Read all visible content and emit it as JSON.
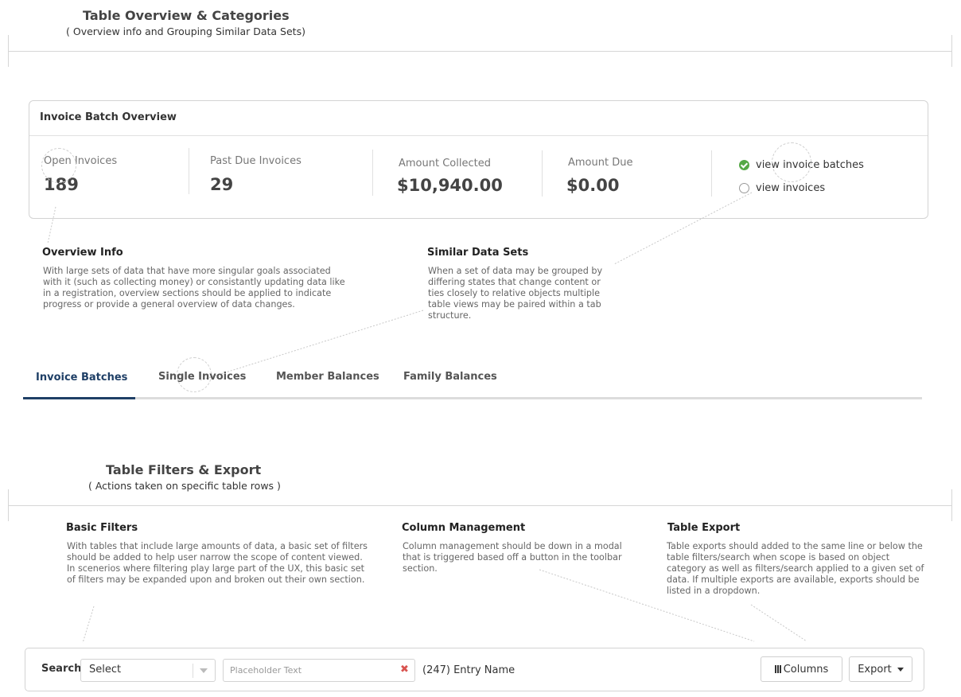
{
  "section1": {
    "title": "Table Overview & Categories",
    "subtitle": "( Overview info and Grouping Similar Data Sets)"
  },
  "overview_card": {
    "title": "Invoice Batch Overview",
    "stats": [
      {
        "label": "Open Invoices",
        "value": "189"
      },
      {
        "label": "Past Due Invoices",
        "value": "29"
      },
      {
        "label": "Amount Collected",
        "value": "$10,940.00"
      },
      {
        "label": "Amount Due",
        "value": "$0.00"
      }
    ],
    "view_options": [
      {
        "label": "view invoice batches",
        "selected": true
      },
      {
        "label": "view invoices",
        "selected": false
      }
    ]
  },
  "notes_overview": [
    {
      "title": "Overview Info",
      "text": "With large sets of data that have more singular goals associated with it (such as collecting money) or consistantly updating data like in a registration, overview sections should be applied to indicate progress or provide a general overview of data changes."
    },
    {
      "title": "Similar Data Sets",
      "text": "When a set of data may be grouped by differing states that change content or ties closely to relative objects multiple table views may be paired within a tab structure."
    }
  ],
  "tabs": [
    {
      "label": "Invoice Batches",
      "active": true
    },
    {
      "label": "Single Invoices",
      "active": false
    },
    {
      "label": "Member Balances",
      "active": false
    },
    {
      "label": "Family Balances",
      "active": false
    }
  ],
  "section2": {
    "title": "Table Filters & Export",
    "subtitle": "( Actions taken on specific table rows )"
  },
  "notes_filters": [
    {
      "title": "Basic Filters",
      "text": "With tables that include large amounts of data, a basic set of filters should be added to help user narrow the scope of content viewed. In scenerios where filtering play large part of the UX, this basic set of filters may be expanded upon and broken out their own section."
    },
    {
      "title": "Column Management",
      "text": "Column management should be down in a modal that is triggered based off a button in the toolbar section."
    },
    {
      "title": "Table Export",
      "text": "Table exports should added to the same line or below the table filters/search when scope is based on object category as well as filters/search applied to a given set of data. If multiple exports are available, exports should be listed in a dropdown."
    }
  ],
  "toolbar": {
    "search_label": "Search",
    "select_value": "Select",
    "search_placeholder": "Placeholder Text",
    "clear_icon": "✖",
    "entry_count": "(247) Entry Name",
    "columns_label": "Columns",
    "export_label": "Export"
  },
  "colors": {
    "accent": "#1f3f66",
    "success": "#55a846",
    "danger": "#d9534f"
  }
}
